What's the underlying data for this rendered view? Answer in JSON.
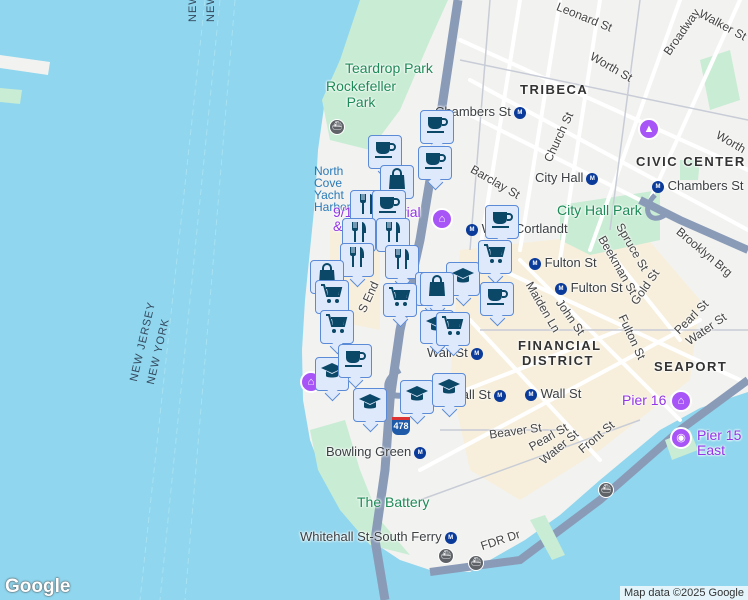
{
  "map": {
    "colors": {
      "water": "#8fd6ee",
      "land": "#f2f2f0",
      "park": "#c9ecd4",
      "highway": "#8a9bb8",
      "marker_fill": "#dfe9fc",
      "marker_border": "#5b8ad6",
      "marker_icon": "#0b4868",
      "poi": "#a855f7"
    },
    "states": {
      "nj": "NEW JERSEY",
      "ny": "NEW YORK"
    },
    "neighborhoods": {
      "tribeca": "TRIBECA",
      "civic_center": "CIVIC CENTER",
      "financial_district": "FINANCIAL DISTRICT",
      "seaport": "SEAPORT"
    },
    "parks": {
      "teardrop": "Teardrop Park",
      "rockefeller": "Rockefeller Park",
      "city_hall_park": "City Hall Park",
      "battery": "The Battery"
    },
    "water": {
      "north_cove": "North Cove Yacht Harbor"
    },
    "streets": {
      "leonard": "Leonard St",
      "worth": "Worth St",
      "worth2": "Worth",
      "broadway": "Broadway",
      "walker": "Walker St",
      "church": "Church St",
      "barclay": "Barclay St",
      "spruce": "Spruce St",
      "beekman": "Beekman St",
      "gold": "Gold St",
      "fulton": "Fulton St",
      "john": "John St",
      "maiden": "Maiden Ln",
      "pearl": "Pearl St",
      "pearl2": "Pearl St",
      "water": "Water St",
      "water2": "Water St",
      "front": "Front St",
      "beaver": "Beaver St",
      "brooklyn_brg": "Brooklyn Brg",
      "fdr": "FDR Dr",
      "s_end": "S End",
      "interstate": "478"
    },
    "stations": {
      "chambers1": "Chambers St",
      "chambers2": "Chambers St",
      "city_hall": "City Hall",
      "wtc": "WTC Cortlandt",
      "fulton1": "Fulton St",
      "fulton2": "Fulton St",
      "wall1": "Wall St",
      "wall2": "Wall St",
      "wall3": "Wall St",
      "bowling": "Bowling Green",
      "whitehall": "Whitehall St-South Ferry"
    },
    "pois": {
      "memorial": "9/11 Memorial & Museum",
      "pier16": "Pier 16",
      "pier15": "Pier 15 East River Esplanade"
    },
    "markers": [
      "coffee",
      "coffee",
      "coffee",
      "shopping-bag",
      "restaurant",
      "coffee",
      "restaurant",
      "restaurant",
      "restaurant",
      "shopping-bag",
      "shopping-cart",
      "restaurant",
      "shopping-bag",
      "school",
      "shopping-cart",
      "coffee",
      "shopping-cart",
      "shopping-bag",
      "shopping-cart",
      "school",
      "shopping-cart",
      "coffee",
      "school",
      "school",
      "school",
      "school",
      "coffee"
    ]
  },
  "branding": {
    "logo": "Google",
    "attribution": "Map data ©2025 Google"
  }
}
